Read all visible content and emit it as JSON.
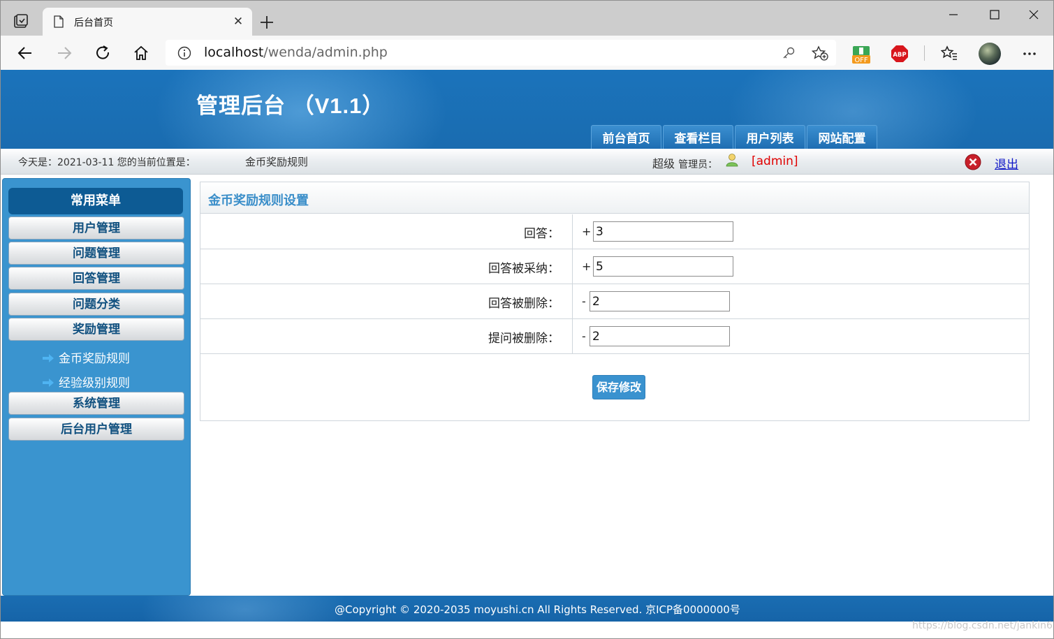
{
  "browser": {
    "tab_title": "后台首页",
    "url_host": "localhost",
    "url_path": "/wenda/admin.php",
    "extension_off_label": "OFF",
    "extension_abp_label": "ABP"
  },
  "header": {
    "title": "管理后台  （V1.1）",
    "nav": [
      "前台首页",
      "查看栏目",
      "用户列表",
      "网站配置"
    ]
  },
  "status": {
    "date_label": "今天是：2021-03-11 您的当前位置是：",
    "location": "金币奖励规则",
    "role_prefix": "超级",
    "role_suffix": "管理员：",
    "username": "[admin]",
    "logout": "退出"
  },
  "sidebar": {
    "header": "常用菜单",
    "menu": [
      "用户管理",
      "问题管理",
      "回答管理",
      "问题分类",
      "奖励管理"
    ],
    "submenu": [
      "金币奖励规则",
      "经验级别规则"
    ],
    "menu_after": [
      "系统管理",
      "后台用户管理"
    ]
  },
  "form": {
    "title": "金币奖励规则设置",
    "rows": [
      {
        "label": "回答：",
        "sign": "+",
        "value": "3"
      },
      {
        "label": "回答被采纳：",
        "sign": "+",
        "value": "5"
      },
      {
        "label": "回答被删除：",
        "sign": "-",
        "value": "2"
      },
      {
        "label": "提问被删除：",
        "sign": "-",
        "value": "2"
      }
    ],
    "save_label": "保存修改"
  },
  "footer": {
    "copyright": "@Copyright © 2020-2035 moyushi.cn All Rights Reserved. 京ICP备0000000号"
  },
  "watermark": "https://blog.csdn.net/jankin6"
}
